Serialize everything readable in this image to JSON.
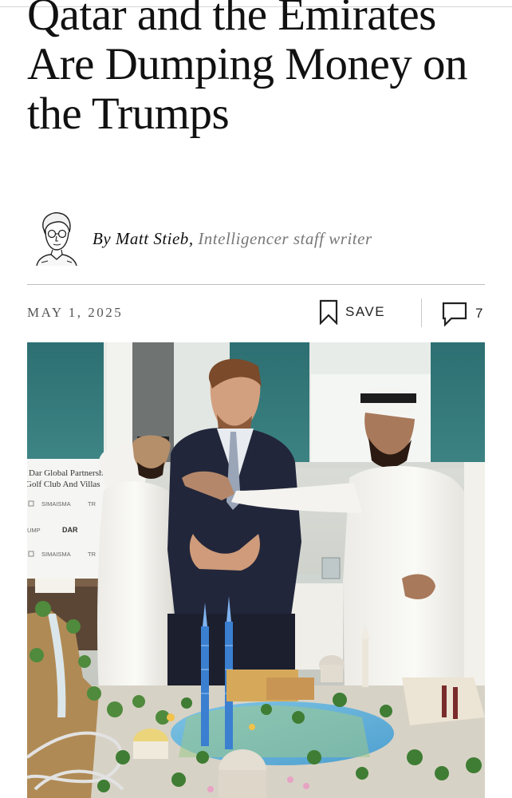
{
  "article": {
    "headline": "Qatar and the Emirates Are Dumping Money on the Trumps",
    "byline_prefix": "By",
    "author": "Matt Stieb",
    "author_role": "Intelligencer staff writer",
    "date": "MAY 1, 2025"
  },
  "actions": {
    "save_label": "SAVE",
    "save_icon": "bookmark-icon",
    "comments_icon": "comment-bubble-icon",
    "comment_count": "7"
  },
  "hero_image": {
    "sign_line_1": "Dar Global Partnershi",
    "sign_line_2": "Golf Club And Villas",
    "logos": [
      "SIMAISMA",
      "TR",
      "UMP",
      "DAR",
      "SIMAISMA",
      "TR"
    ]
  }
}
